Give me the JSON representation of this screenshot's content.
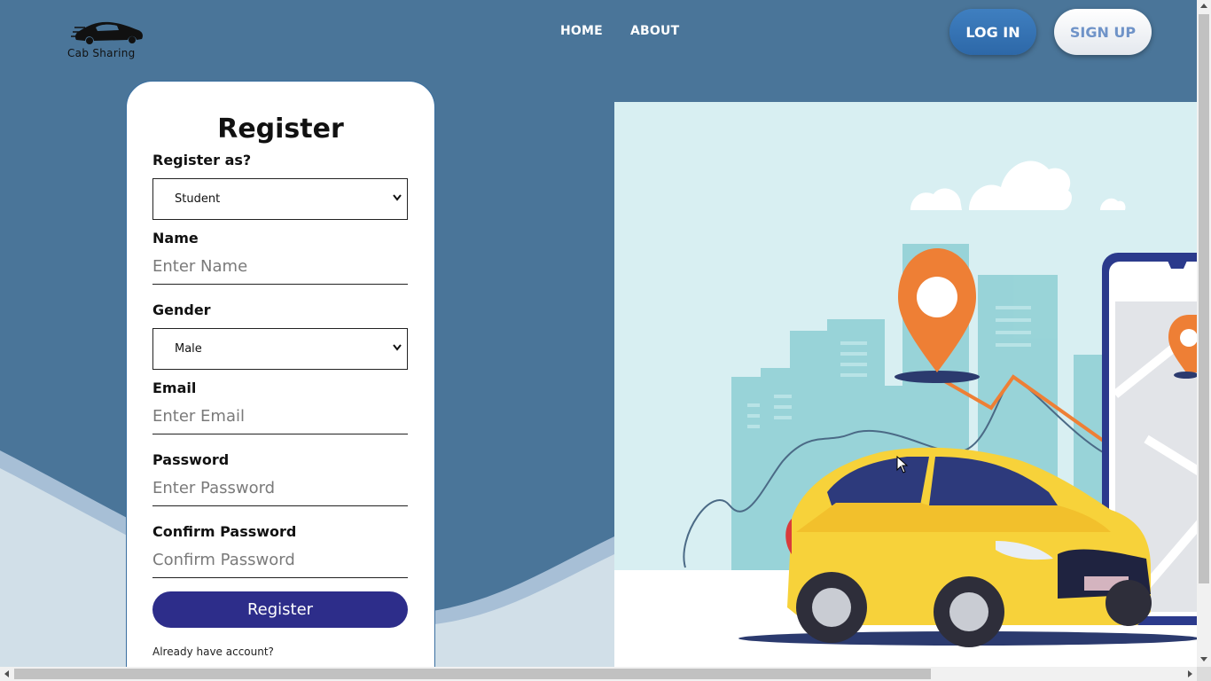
{
  "brand": {
    "name": "Cab Sharing",
    "logo_icon": "car-logo-icon"
  },
  "nav": {
    "links": [
      {
        "label": "HOME"
      },
      {
        "label": "ABOUT"
      }
    ],
    "login_label": "LOG IN",
    "signup_label": "SIGN UP"
  },
  "form": {
    "title": "Register",
    "register_as": {
      "label": "Register as?",
      "value": "Student"
    },
    "name": {
      "label": "Name",
      "placeholder": "Enter Name"
    },
    "gender": {
      "label": "Gender",
      "value": "Male"
    },
    "email": {
      "label": "Email",
      "placeholder": "Enter Email"
    },
    "password": {
      "label": "Password",
      "placeholder": "Enter Password"
    },
    "confirm_password": {
      "label": "Confirm Password",
      "placeholder": "Confirm Password"
    },
    "submit_label": "Register",
    "footer_text": "Already have account?"
  },
  "colors": {
    "background": "#4a7599",
    "card": "#ffffff",
    "register_button": "#2d2d8a",
    "login_button": "#3f7fc0",
    "signup_text": "#6f93c8",
    "illustration_bg": "#d8eff2",
    "taxi_yellow": "#f7d23a",
    "pin_orange": "#ee7f35"
  },
  "illustration": {
    "subject": "yellow taxi with map pins, city skyline and smartphone"
  }
}
